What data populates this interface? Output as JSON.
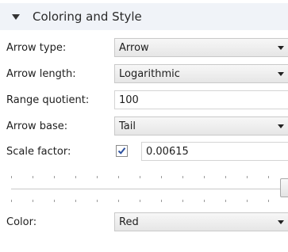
{
  "section": {
    "title": "Coloring and Style"
  },
  "fields": {
    "arrow_type": {
      "label": "Arrow type:",
      "value": "Arrow"
    },
    "arrow_length": {
      "label": "Arrow length:",
      "value": "Logarithmic"
    },
    "range_quotient": {
      "label": "Range quotient:",
      "value": "100"
    },
    "arrow_base": {
      "label": "Arrow base:",
      "value": "Tail"
    },
    "scale_factor": {
      "label": "Scale factor:",
      "value": "0.00615",
      "checked": true
    },
    "color": {
      "label": "Color:",
      "value": "Red"
    }
  },
  "slider": {
    "position_fraction": 1.0
  },
  "icons": {
    "section_toggle": "caret-down-icon",
    "combo_arrow": "chevron-down-icon",
    "checkmark": "checkmark-icon"
  },
  "colors": {
    "header_bg": "#f0f3f8",
    "checkmark": "#2b4f9e"
  }
}
